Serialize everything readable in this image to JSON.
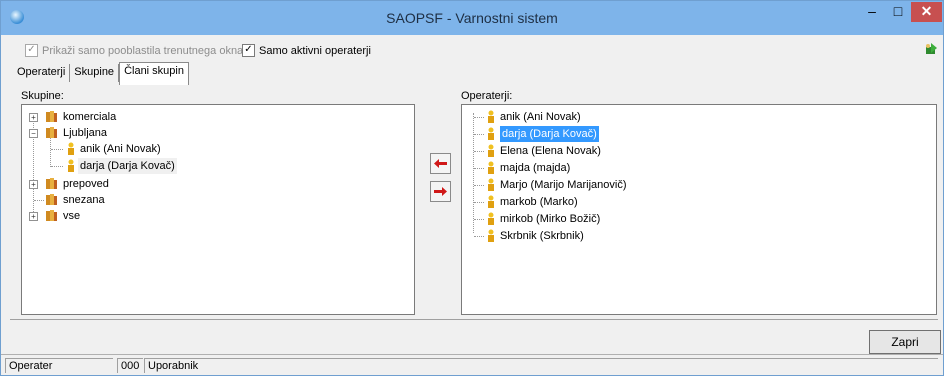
{
  "window": {
    "title": "SAOPSF - Varnostni sistem"
  },
  "options": {
    "show_current_window_label": "Prikaži samo pooblastila trenutnega okna",
    "show_current_window_checked": true,
    "active_only_label": "Samo aktivni operaterji",
    "active_only_checked": true
  },
  "tabs": [
    {
      "label": "Operaterji"
    },
    {
      "label": "Skupine"
    },
    {
      "label": "Člani skupin",
      "active": true
    }
  ],
  "left_panel": {
    "label": "Skupine:",
    "groups": [
      {
        "label": "komerciala"
      },
      {
        "label": "Ljubljana",
        "members": [
          "anik (Ani Novak)",
          "darja (Darja Kovač)"
        ]
      },
      {
        "label": "prepoved"
      },
      {
        "label": "snezana"
      },
      {
        "label": "vse"
      }
    ]
  },
  "right_panel": {
    "label": "Operaterji:",
    "operators": [
      "anik (Ani Novak)",
      "darja (Darja Kovač)",
      "Elena (Elena Novak)",
      "majda (majda)",
      "Marjo (Marijo Marijanovič)",
      "markob (Marko)",
      "mirkob (Mirko Božič)",
      "Skrbnik (Skrbnik)"
    ],
    "selected": "darja (Darja Kovač)"
  },
  "buttons": {
    "close_label": "Zapri"
  },
  "status": {
    "field1": "Operater",
    "field2": "000",
    "field3": "Uporabnik"
  },
  "colors": {
    "titlebar": "#7eb4ea",
    "selection": "#3399ff",
    "close": "#c75050",
    "arrow": "#d01818"
  }
}
